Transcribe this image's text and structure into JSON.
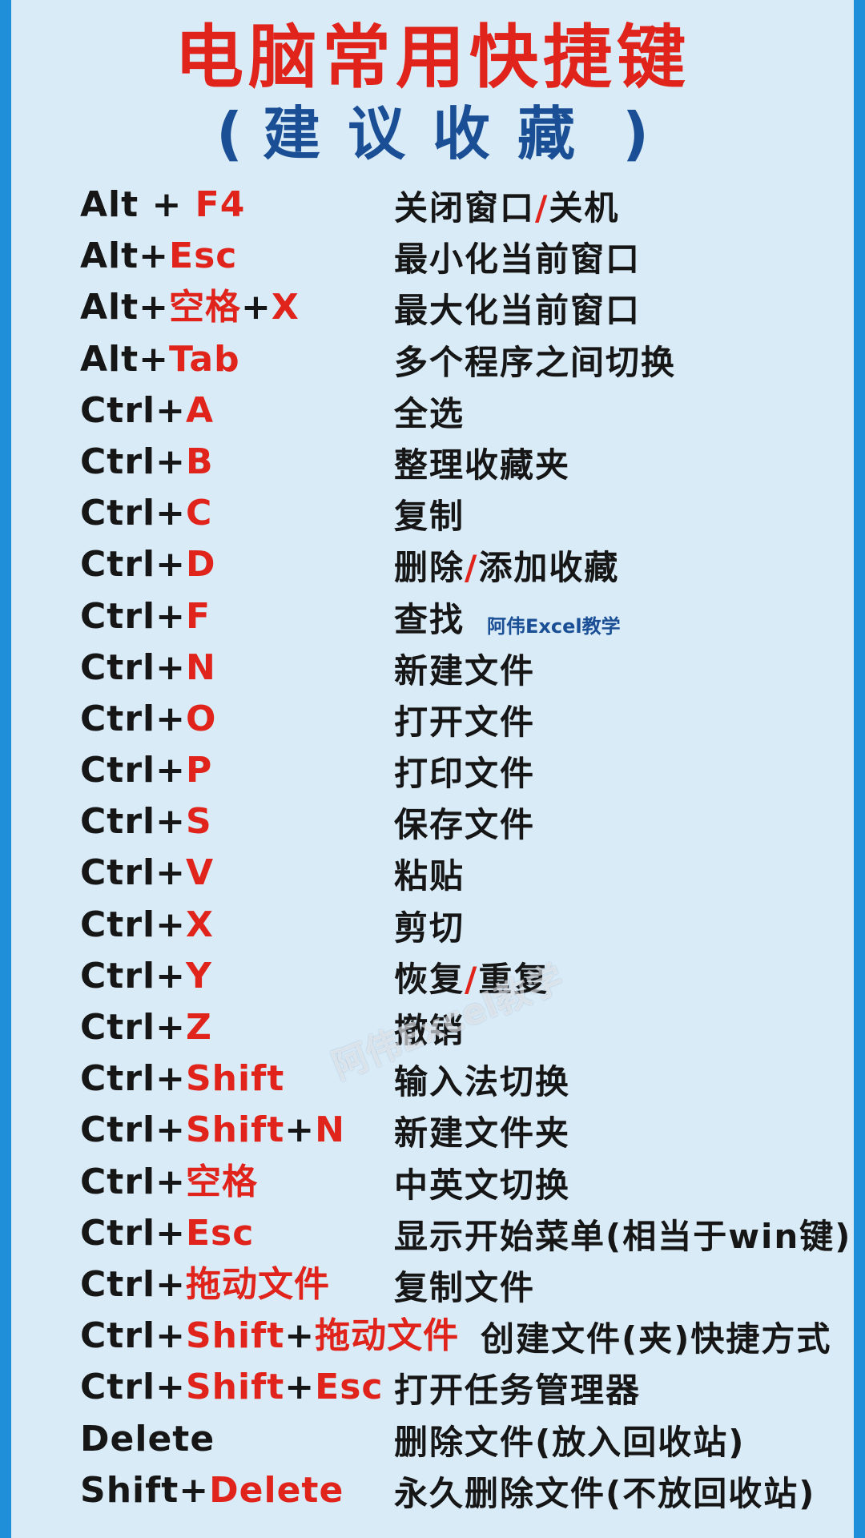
{
  "header": {
    "title": "电脑常用快捷键",
    "subtitle_open": "(",
    "subtitle_text": "建议收藏",
    "subtitle_close": ")"
  },
  "brand_label": "阿伟Excel教学",
  "watermark_text": "阿伟Excel教学",
  "colors": {
    "accent_red": "#e0241c",
    "brand_blue": "#1a4f96",
    "background": "#d9ebf7",
    "border": "#1e8fd8"
  },
  "shortcuts": [
    {
      "key": [
        "Alt + ",
        "F4"
      ],
      "desc": [
        "关闭窗口",
        "/",
        "关机"
      ]
    },
    {
      "key": [
        "Alt+",
        "Esc"
      ],
      "desc": [
        "最小化当前窗口",
        "",
        ""
      ]
    },
    {
      "key": [
        "Alt+",
        "空格",
        "+",
        "X"
      ],
      "desc": [
        "最大化当前窗口",
        "",
        ""
      ]
    },
    {
      "key": [
        "Alt+",
        "Tab"
      ],
      "desc": [
        "多个程序之间切换",
        "",
        ""
      ]
    },
    {
      "key": [
        "Ctrl+",
        "A"
      ],
      "desc": [
        "全选",
        "",
        ""
      ]
    },
    {
      "key": [
        "Ctrl+",
        "B"
      ],
      "desc": [
        "整理收藏夹",
        "",
        ""
      ]
    },
    {
      "key": [
        "Ctrl+",
        "C"
      ],
      "desc": [
        "复制",
        "",
        ""
      ]
    },
    {
      "key": [
        "Ctrl+",
        "D"
      ],
      "desc": [
        "删除",
        "/",
        "添加收藏"
      ]
    },
    {
      "key": [
        "Ctrl+",
        "F"
      ],
      "desc": [
        "查找",
        "",
        ""
      ]
    },
    {
      "key": [
        "Ctrl+",
        "N"
      ],
      "desc": [
        "新建文件",
        "",
        ""
      ]
    },
    {
      "key": [
        "Ctrl+",
        "O"
      ],
      "desc": [
        "打开文件",
        "",
        ""
      ]
    },
    {
      "key": [
        "Ctrl+",
        "P"
      ],
      "desc": [
        "打印文件",
        "",
        ""
      ]
    },
    {
      "key": [
        "Ctrl+",
        "S"
      ],
      "desc": [
        "保存文件",
        "",
        ""
      ]
    },
    {
      "key": [
        "Ctrl+",
        "V"
      ],
      "desc": [
        "粘贴",
        "",
        ""
      ]
    },
    {
      "key": [
        "Ctrl+",
        "X"
      ],
      "desc": [
        "剪切",
        "",
        ""
      ]
    },
    {
      "key": [
        "Ctrl+",
        "Y"
      ],
      "desc": [
        "恢复",
        "/",
        "重复"
      ]
    },
    {
      "key": [
        "Ctrl+",
        "Z"
      ],
      "desc": [
        "撤销",
        "",
        ""
      ]
    },
    {
      "key": [
        "Ctrl+",
        "Shift"
      ],
      "desc": [
        "输入法切换",
        "",
        ""
      ]
    },
    {
      "key": [
        "Ctrl+",
        "Shift",
        "+",
        "N"
      ],
      "desc": [
        "新建文件夹",
        "",
        ""
      ]
    },
    {
      "key": [
        "Ctrl+",
        "空格"
      ],
      "desc": [
        "中英文切换",
        "",
        ""
      ]
    },
    {
      "key": [
        "Ctrl+",
        "Esc"
      ],
      "desc": [
        "显示开始菜单(相当于win键)",
        "",
        ""
      ]
    },
    {
      "key": [
        "Ctrl+",
        "拖动文件"
      ],
      "desc": [
        "复制文件",
        "",
        ""
      ]
    },
    {
      "key": [
        "Ctrl+",
        "Shift",
        "+",
        "拖动文件"
      ],
      "desc": [
        "创建文件(夹)快捷方式",
        "",
        ""
      ]
    },
    {
      "key": [
        "Ctrl+",
        "Shift",
        "+",
        "Esc"
      ],
      "desc": [
        "打开任务管理器",
        "",
        ""
      ]
    },
    {
      "key": [
        "Delete"
      ],
      "desc": [
        "删除文件(放入回收站)",
        "",
        ""
      ]
    },
    {
      "key": [
        "Shift+",
        "Delete"
      ],
      "desc": [
        "永久删除文件(不放回收站)",
        "",
        ""
      ]
    }
  ]
}
